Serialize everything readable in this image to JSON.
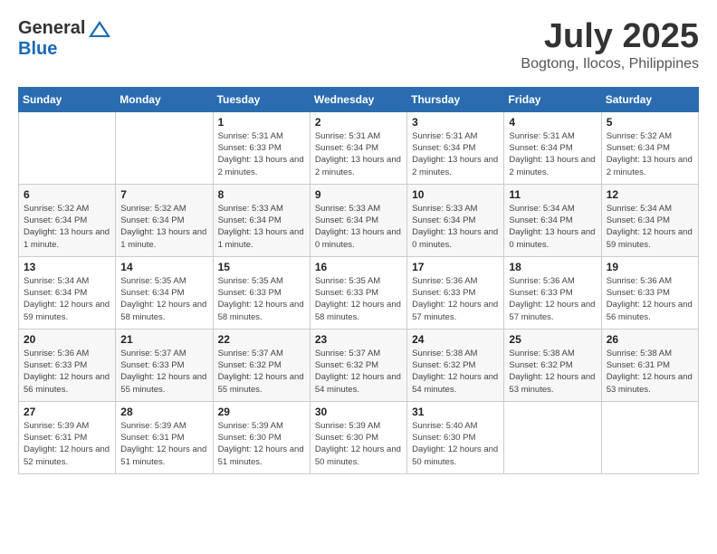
{
  "header": {
    "logo_general": "General",
    "logo_blue": "Blue",
    "month_title": "July 2025",
    "location": "Bogtong, Ilocos, Philippines"
  },
  "calendar": {
    "days_of_week": [
      "Sunday",
      "Monday",
      "Tuesday",
      "Wednesday",
      "Thursday",
      "Friday",
      "Saturday"
    ],
    "weeks": [
      [
        {
          "day": "",
          "info": ""
        },
        {
          "day": "",
          "info": ""
        },
        {
          "day": "1",
          "info": "Sunrise: 5:31 AM\nSunset: 6:33 PM\nDaylight: 13 hours and 2 minutes."
        },
        {
          "day": "2",
          "info": "Sunrise: 5:31 AM\nSunset: 6:34 PM\nDaylight: 13 hours and 2 minutes."
        },
        {
          "day": "3",
          "info": "Sunrise: 5:31 AM\nSunset: 6:34 PM\nDaylight: 13 hours and 2 minutes."
        },
        {
          "day": "4",
          "info": "Sunrise: 5:31 AM\nSunset: 6:34 PM\nDaylight: 13 hours and 2 minutes."
        },
        {
          "day": "5",
          "info": "Sunrise: 5:32 AM\nSunset: 6:34 PM\nDaylight: 13 hours and 2 minutes."
        }
      ],
      [
        {
          "day": "6",
          "info": "Sunrise: 5:32 AM\nSunset: 6:34 PM\nDaylight: 13 hours and 1 minute."
        },
        {
          "day": "7",
          "info": "Sunrise: 5:32 AM\nSunset: 6:34 PM\nDaylight: 13 hours and 1 minute."
        },
        {
          "day": "8",
          "info": "Sunrise: 5:33 AM\nSunset: 6:34 PM\nDaylight: 13 hours and 1 minute."
        },
        {
          "day": "9",
          "info": "Sunrise: 5:33 AM\nSunset: 6:34 PM\nDaylight: 13 hours and 0 minutes."
        },
        {
          "day": "10",
          "info": "Sunrise: 5:33 AM\nSunset: 6:34 PM\nDaylight: 13 hours and 0 minutes."
        },
        {
          "day": "11",
          "info": "Sunrise: 5:34 AM\nSunset: 6:34 PM\nDaylight: 13 hours and 0 minutes."
        },
        {
          "day": "12",
          "info": "Sunrise: 5:34 AM\nSunset: 6:34 PM\nDaylight: 12 hours and 59 minutes."
        }
      ],
      [
        {
          "day": "13",
          "info": "Sunrise: 5:34 AM\nSunset: 6:34 PM\nDaylight: 12 hours and 59 minutes."
        },
        {
          "day": "14",
          "info": "Sunrise: 5:35 AM\nSunset: 6:34 PM\nDaylight: 12 hours and 58 minutes."
        },
        {
          "day": "15",
          "info": "Sunrise: 5:35 AM\nSunset: 6:33 PM\nDaylight: 12 hours and 58 minutes."
        },
        {
          "day": "16",
          "info": "Sunrise: 5:35 AM\nSunset: 6:33 PM\nDaylight: 12 hours and 58 minutes."
        },
        {
          "day": "17",
          "info": "Sunrise: 5:36 AM\nSunset: 6:33 PM\nDaylight: 12 hours and 57 minutes."
        },
        {
          "day": "18",
          "info": "Sunrise: 5:36 AM\nSunset: 6:33 PM\nDaylight: 12 hours and 57 minutes."
        },
        {
          "day": "19",
          "info": "Sunrise: 5:36 AM\nSunset: 6:33 PM\nDaylight: 12 hours and 56 minutes."
        }
      ],
      [
        {
          "day": "20",
          "info": "Sunrise: 5:36 AM\nSunset: 6:33 PM\nDaylight: 12 hours and 56 minutes."
        },
        {
          "day": "21",
          "info": "Sunrise: 5:37 AM\nSunset: 6:33 PM\nDaylight: 12 hours and 55 minutes."
        },
        {
          "day": "22",
          "info": "Sunrise: 5:37 AM\nSunset: 6:32 PM\nDaylight: 12 hours and 55 minutes."
        },
        {
          "day": "23",
          "info": "Sunrise: 5:37 AM\nSunset: 6:32 PM\nDaylight: 12 hours and 54 minutes."
        },
        {
          "day": "24",
          "info": "Sunrise: 5:38 AM\nSunset: 6:32 PM\nDaylight: 12 hours and 54 minutes."
        },
        {
          "day": "25",
          "info": "Sunrise: 5:38 AM\nSunset: 6:32 PM\nDaylight: 12 hours and 53 minutes."
        },
        {
          "day": "26",
          "info": "Sunrise: 5:38 AM\nSunset: 6:31 PM\nDaylight: 12 hours and 53 minutes."
        }
      ],
      [
        {
          "day": "27",
          "info": "Sunrise: 5:39 AM\nSunset: 6:31 PM\nDaylight: 12 hours and 52 minutes."
        },
        {
          "day": "28",
          "info": "Sunrise: 5:39 AM\nSunset: 6:31 PM\nDaylight: 12 hours and 51 minutes."
        },
        {
          "day": "29",
          "info": "Sunrise: 5:39 AM\nSunset: 6:30 PM\nDaylight: 12 hours and 51 minutes."
        },
        {
          "day": "30",
          "info": "Sunrise: 5:39 AM\nSunset: 6:30 PM\nDaylight: 12 hours and 50 minutes."
        },
        {
          "day": "31",
          "info": "Sunrise: 5:40 AM\nSunset: 6:30 PM\nDaylight: 12 hours and 50 minutes."
        },
        {
          "day": "",
          "info": ""
        },
        {
          "day": "",
          "info": ""
        }
      ]
    ]
  }
}
